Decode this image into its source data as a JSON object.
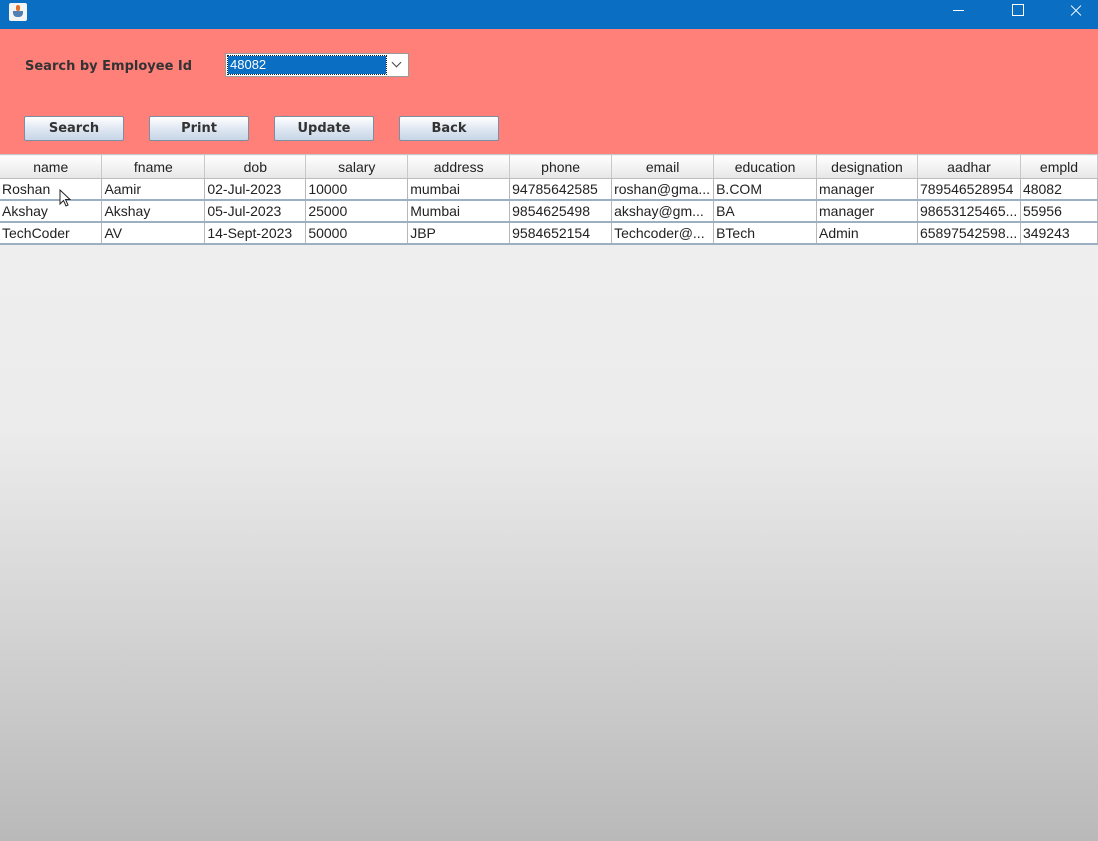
{
  "window": {
    "icon": "java-cup-icon"
  },
  "search": {
    "label": "Search by Employee Id",
    "selected": "48082"
  },
  "buttons": {
    "search": "Search",
    "print": "Print",
    "update": "Update",
    "back": "Back"
  },
  "table": {
    "headers": [
      "name",
      "fname",
      "dob",
      "salary",
      "address",
      "phone",
      "email",
      "education",
      "designation",
      "aadhar",
      "empld"
    ],
    "rows": [
      [
        "Roshan",
        "Aamir",
        "02-Jul-2023",
        "10000",
        "mumbai",
        "94785642585",
        "roshan@gma...",
        "B.COM",
        "manager",
        "789546528954",
        "48082"
      ],
      [
        "Akshay",
        "Akshay",
        "05-Jul-2023",
        "25000",
        "Mumbai",
        "9854625498",
        "akshay@gm...",
        "BA",
        "manager",
        "98653125465...",
        "55956"
      ],
      [
        "TechCoder",
        "AV",
        "14-Sept-2023",
        "50000",
        "JBP",
        "9584652154",
        "Techcoder@...",
        "BTech",
        "Admin",
        "65897542598...",
        "349243"
      ]
    ]
  },
  "colors": {
    "titlebar": "#0a6fc2",
    "panel": "#ff7f79",
    "selection": "#0a6fc2"
  }
}
